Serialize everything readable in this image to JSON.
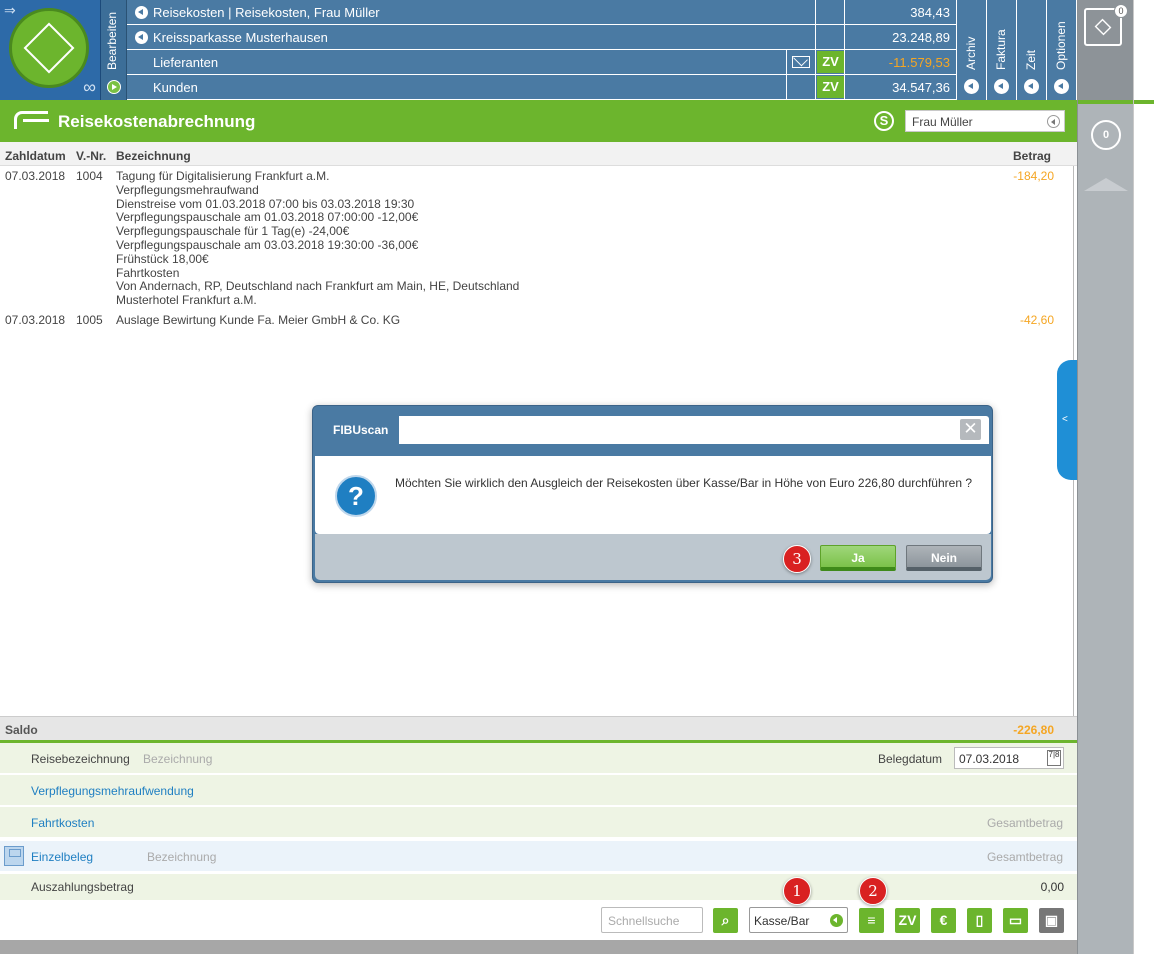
{
  "header": {
    "bearbeiten_label": "Bearbeiten",
    "rows": [
      {
        "label": "Reisekosten | Reisekosten, Frau Müller",
        "value": "384,43"
      },
      {
        "label": "Kreissparkasse Musterhausen",
        "value": "23.248,89"
      },
      {
        "label": "Lieferanten",
        "badge": "ZV",
        "value": "-11.579,53"
      },
      {
        "label": "Kunden",
        "badge": "ZV",
        "value": "34.547,36"
      }
    ],
    "tabs": [
      "Archiv",
      "Faktura",
      "Zeit",
      "Optionen"
    ]
  },
  "right_bar": {
    "dropbox_badge": "0",
    "counter": "0"
  },
  "title_bar": {
    "title": "Reisekostenabrechnung",
    "s_label": "S",
    "person_select": "Frau Müller"
  },
  "table": {
    "headers": [
      "Zahldatum",
      "V.-Nr.",
      "Bezeichnung",
      "Betrag"
    ],
    "rows": [
      {
        "date": "07.03.2018",
        "nr": "1004",
        "lines": [
          "Tagung für Digitalisierung Frankfurt a.M.",
          "Verpflegungsmehraufwand",
          "Dienstreise vom 01.03.2018 07:00 bis 03.03.2018 19:30",
          "Verpflegungspauschale am 01.03.2018 07:00:00 -12,00€",
          "Verpflegungspauschale für  1 Tag(e) -24,00€",
          "Verpflegungspauschale am 03.03.2018 19:30:00 -36,00€",
          "Frühstück 18,00€",
          "Fahrtkosten",
          "Von Andernach, RP, Deutschland nach Frankfurt am Main, HE, Deutschland",
          "Musterhotel Frankfurt a.M."
        ],
        "amount": "-184,20"
      },
      {
        "date": "07.03.2018",
        "nr": "1005",
        "lines": [
          "Auslage Bewirtung Kunde Fa. Meier GmbH & Co. KG"
        ],
        "amount": "-42,60"
      }
    ],
    "side_tab": "<"
  },
  "saldo": {
    "label": "Saldo",
    "value": "-226,80"
  },
  "form": {
    "reise_label": "Reisebezeichnung",
    "reise_placeholder": "Bezeichnung",
    "belegdatum_label": "Belegdatum",
    "belegdatum_value": "07.03.2018",
    "calendar_glyph": "7|8",
    "verpflegung_label": "Verpflegungsmehraufwendung",
    "fahrtkosten_label": "Fahrtkosten",
    "fahrtkosten_placeholder": "Gesamtbetrag",
    "einzelbeleg_label": "Einzelbeleg",
    "einzelbeleg_placeholder": "Bezeichnung",
    "einzelbeleg_amount_placeholder": "Gesamtbetrag",
    "auszahlung_label": "Auszahlungsbetrag",
    "auszahlung_value": "0,00"
  },
  "toolbar": {
    "search_placeholder": "Schnellsuche",
    "payment_select": "Kasse/Bar",
    "zv_label": "ZV",
    "euro_label": "€"
  },
  "markers": [
    "1",
    "2",
    "3"
  ],
  "dialog": {
    "title": "FIBUscan",
    "close_glyph": "✕",
    "question_glyph": "?",
    "message": "Möchten Sie wirklich den Ausgleich der Reisekosten über Kasse/Bar in Höhe von Euro 226,80 durchführen ?",
    "yes_label": "Ja",
    "no_label": "Nein"
  },
  "colors": {
    "header_blue": "#4a7aa3",
    "brand_green": "#6cb52d",
    "negative_orange": "#f5a623",
    "link_blue": "#1f7fc2",
    "marker_red": "#d92121"
  }
}
